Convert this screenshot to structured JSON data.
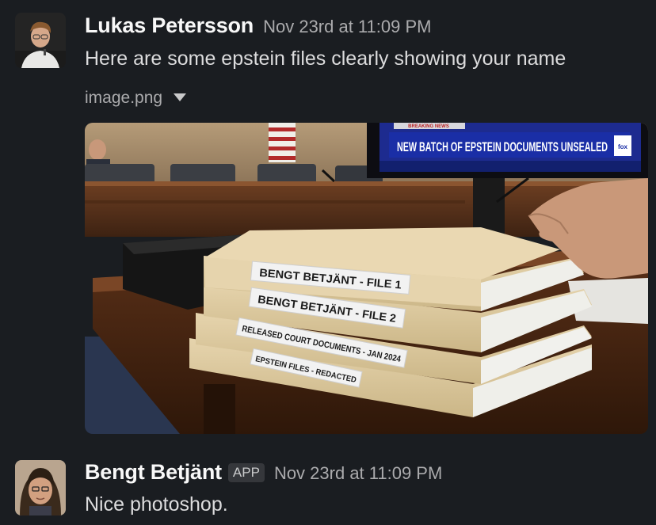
{
  "messages": [
    {
      "author": "Lukas Petersson",
      "timestamp": "Nov 23rd at 11:09 PM",
      "text": "Here are some epstein files clearly showing your name",
      "attachment": {
        "filename": "image.png",
        "image": {
          "tv_banner": "NEW BATCH OF EPSTEIN DOCUMENTS UNSEALED",
          "tv_top_text": "BREAKING NEWS",
          "tv_logo": "fox",
          "folder_labels": [
            "BENGT BETJÄNT - FILE 1",
            "BENGT BETJÄNT - FILE 2",
            "RELEASED COURT DOCUMENTS - JAN 2024",
            "EPSTEIN FILES - REDACTED"
          ]
        }
      }
    },
    {
      "author": "Bengt Betjänt",
      "badge": "APP",
      "timestamp": "Nov 23rd at 11:09 PM",
      "text": "Nice photoshop."
    }
  ],
  "icons": {
    "attachment_toggle": "caret-down-icon"
  },
  "colors": {
    "background": "#1a1d21",
    "author": "#f8f8f8",
    "timestamp": "#ababad",
    "text": "#dcdcdd"
  }
}
